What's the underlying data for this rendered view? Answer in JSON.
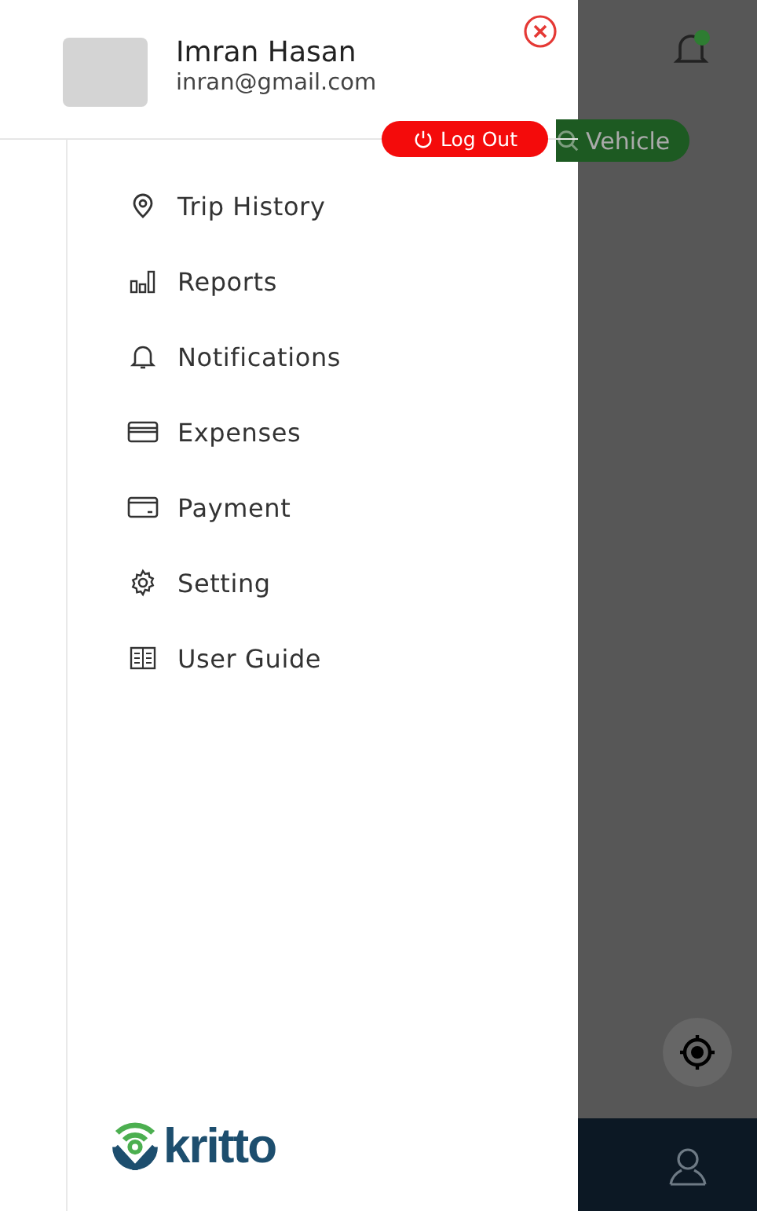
{
  "profile": {
    "name": "Imran Hasan",
    "email": "inran@gmail.com"
  },
  "logout": {
    "label": "Log Out"
  },
  "menu": [
    {
      "kind": "pin",
      "label": "Trip History"
    },
    {
      "kind": "bars",
      "label": "Reports"
    },
    {
      "kind": "bell",
      "label": "Notifications"
    },
    {
      "kind": "card",
      "label": "Expenses"
    },
    {
      "kind": "wallet",
      "label": "Payment"
    },
    {
      "kind": "gear",
      "label": "Setting"
    },
    {
      "kind": "book",
      "label": "User Guide"
    }
  ],
  "logo": {
    "text": "kritto"
  },
  "background": {
    "search_button": "Vehicle"
  }
}
